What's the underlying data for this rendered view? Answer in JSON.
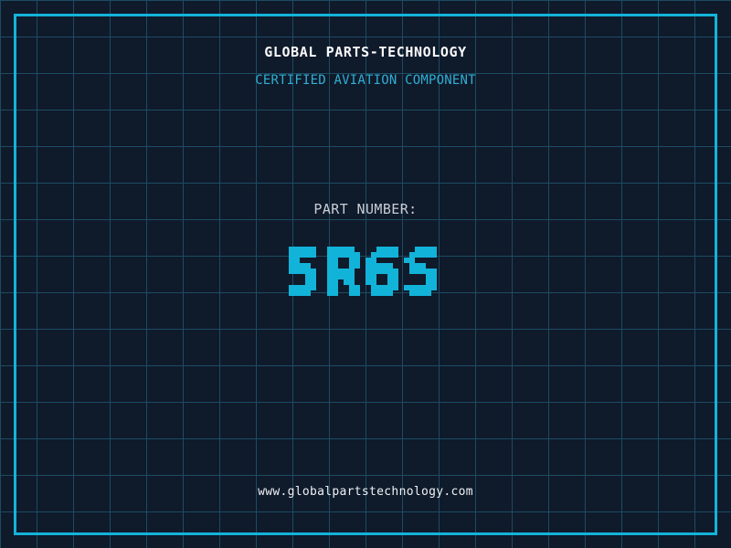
{
  "theme": {
    "background": "#0f1a2b",
    "grid_line": "#1c4c62",
    "frame_color": "#14b3da",
    "title_color": "#fafafa",
    "subtitle_color": "#30aed3",
    "label_color": "#c8cdd5",
    "part_number_color": "#12b3d9",
    "footer_color": "#eef2f5"
  },
  "header": {
    "title": "GLOBAL PARTS-TECHNOLOGY",
    "subtitle": "CERTIFIED AVIATION COMPONENT"
  },
  "part": {
    "label": "PART NUMBER:",
    "value": "5R6S"
  },
  "footer": {
    "url": "www.globalpartstechnology.com"
  }
}
